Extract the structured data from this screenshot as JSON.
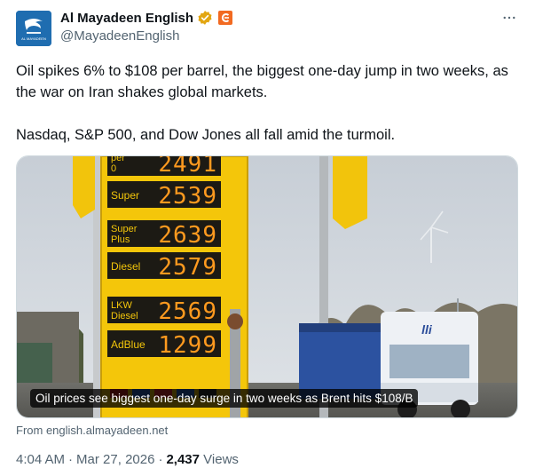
{
  "author": {
    "display_name": "Al Mayadeen English",
    "handle": "@MayadeenEnglish",
    "avatar_text": "AL MAYADEEN",
    "verified_icon": "gold-verified-badge-icon",
    "affiliate_icon": "orange-affiliate-logo-icon"
  },
  "tweet": {
    "paragraph1": "Oil spikes 6% to $108 per barrel, the biggest one-day jump in two weeks, as the war on Iran shakes global markets.",
    "paragraph2": "Nasdaq, S&P 500, and Dow Jones all fall amid the turmoil."
  },
  "card": {
    "caption": "Oil prices see biggest one-day surge in two weeks as Brent hits $108/B",
    "source": "From english.almayadeen.net",
    "sign": [
      {
        "label": "per\n0",
        "price": "2491"
      },
      {
        "label": "Super",
        "price": "2539"
      },
      {
        "label": "Super\nPlus",
        "price": "2639"
      },
      {
        "label": "Diesel",
        "price": "2579"
      },
      {
        "label": "LKW\nDiesel",
        "price": "2569"
      },
      {
        "label": "AdBlue",
        "price": "1299"
      }
    ],
    "truck_text": "lli"
  },
  "meta": {
    "time": "4:04 AM",
    "date": "Mar 27, 2026",
    "views_count": "2,437",
    "views_label": "Views",
    "separator": "·"
  },
  "colors": {
    "sign_yellow": "#f4c60a",
    "price_orange": "#ff9a1f",
    "brand_blue": "#1f6db0",
    "text_secondary": "#536471"
  }
}
